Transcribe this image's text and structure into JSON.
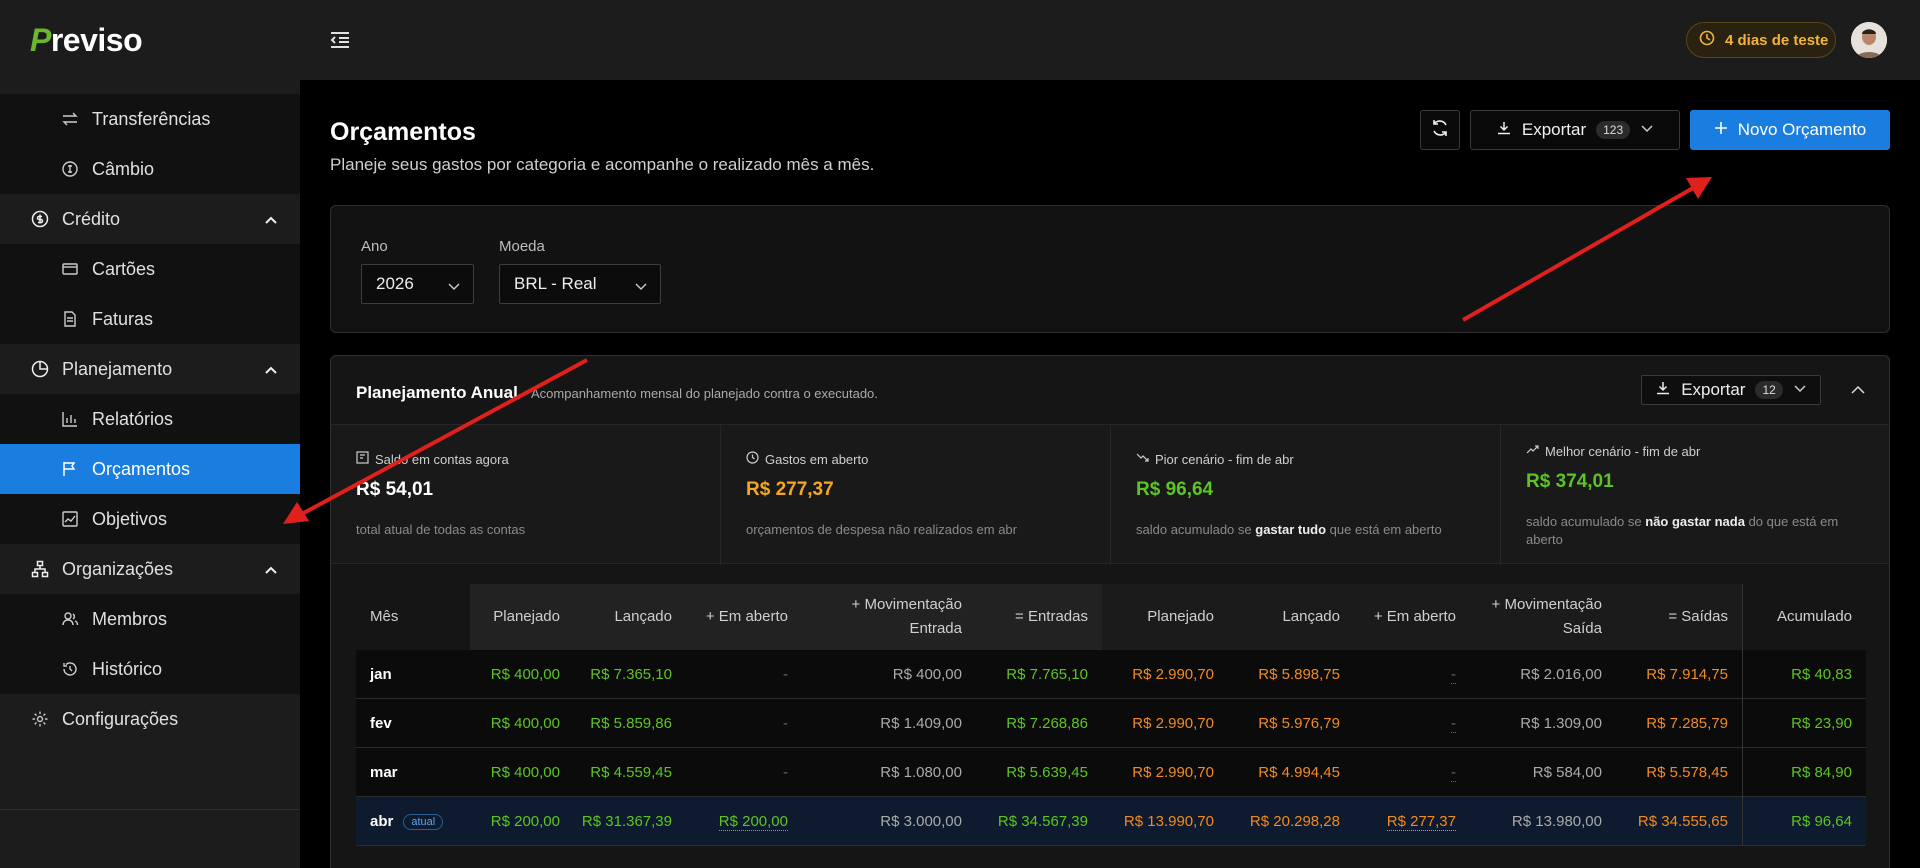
{
  "app": {
    "logo_initial": "P",
    "logo_rest": "reviso"
  },
  "header": {
    "trial_label": "4 dias de teste"
  },
  "sidebar": {
    "items": [
      {
        "label": "Transferências"
      },
      {
        "label": "Câmbio"
      },
      {
        "label": "Crédito"
      },
      {
        "label": "Cartões"
      },
      {
        "label": "Faturas"
      },
      {
        "label": "Planejamento"
      },
      {
        "label": "Relatórios"
      },
      {
        "label": "Orçamentos"
      },
      {
        "label": "Objetivos"
      },
      {
        "label": "Organizações"
      },
      {
        "label": "Membros"
      },
      {
        "label": "Histórico"
      },
      {
        "label": "Configurações"
      }
    ]
  },
  "page": {
    "title": "Orçamentos",
    "subtitle": "Planeje seus gastos por categoria e acompanhe o realizado mês a mês.",
    "export_label": "Exportar",
    "export_count": "123",
    "new_label": "Novo Orçamento"
  },
  "filters": {
    "year_label": "Ano",
    "year_value": "2026",
    "currency_label": "Moeda",
    "currency_value": "BRL - Real"
  },
  "plan": {
    "title": "Planejamento Anual",
    "subtitle": "Acompanhamento mensal do planejado contra o executado.",
    "export_label": "Exportar",
    "export_count": "12",
    "kpis": [
      {
        "label": "Saldo em contas agora",
        "value": "R$ 54,01",
        "note": "total atual de todas as contas"
      },
      {
        "label": "Gastos em aberto",
        "value": "R$ 277,37",
        "note": "orçamentos de despesa não realizados em abr"
      },
      {
        "label": "Pior cenário - fim de abr",
        "value": "R$ 96,64",
        "note_pre": "saldo acumulado se ",
        "note_bold": "gastar tudo",
        "note_post": " que está em aberto"
      },
      {
        "label": "Melhor cenário - fim de abr",
        "value": "R$ 374,01",
        "note_pre": "saldo acumulado se ",
        "note_bold": "não gastar nada",
        "note_post": " do que está em aberto"
      }
    ],
    "columns": [
      "Mês",
      "Planejado",
      "Lançado",
      "+ Em aberto",
      "+ Movimentação",
      "Entrada",
      "= Entradas",
      "Planejado",
      "Lançado",
      "+ Em aberto",
      "+ Movimentação",
      "Saída",
      "= Saídas",
      "Acumulado"
    ],
    "current_badge": "atual",
    "rows": [
      {
        "month": "jan",
        "in_planned": "R$ 400,00",
        "in_posted": "R$ 7.365,10",
        "in_open": "-",
        "in_mov": "R$ 400,00",
        "in_total": "R$ 7.765,10",
        "out_planned": "R$ 2.990,70",
        "out_posted": "R$ 5.898,75",
        "out_open": "-",
        "out_mov": "R$ 2.016,00",
        "out_total": "R$ 7.914,75",
        "acc": "R$ 40,83"
      },
      {
        "month": "fev",
        "in_planned": "R$ 400,00",
        "in_posted": "R$ 5.859,86",
        "in_open": "-",
        "in_mov": "R$ 1.409,00",
        "in_total": "R$ 7.268,86",
        "out_planned": "R$ 2.990,70",
        "out_posted": "R$ 5.976,79",
        "out_open": "-",
        "out_mov": "R$ 1.309,00",
        "out_total": "R$ 7.285,79",
        "acc": "R$ 23,90"
      },
      {
        "month": "mar",
        "in_planned": "R$ 400,00",
        "in_posted": "R$ 4.559,45",
        "in_open": "-",
        "in_mov": "R$ 1.080,00",
        "in_total": "R$ 5.639,45",
        "out_planned": "R$ 2.990,70",
        "out_posted": "R$ 4.994,45",
        "out_open": "-",
        "out_mov": "R$ 584,00",
        "out_total": "R$ 5.578,45",
        "acc": "R$ 84,90"
      },
      {
        "month": "abr",
        "in_planned": "R$ 200,00",
        "in_posted": "R$ 31.367,39",
        "in_open": "R$ 200,00",
        "in_mov": "R$ 3.000,00",
        "in_total": "R$ 34.567,39",
        "out_planned": "R$ 13.990,70",
        "out_posted": "R$ 20.298,28",
        "out_open": "R$ 277,37",
        "out_mov": "R$ 13.980,00",
        "out_total": "R$ 34.555,65",
        "acc": "R$ 96,64"
      }
    ]
  },
  "colors": {
    "accent": "#1a7ee0",
    "green": "#5cc524",
    "orange": "#f08a24",
    "arrow": "#e0201c"
  }
}
